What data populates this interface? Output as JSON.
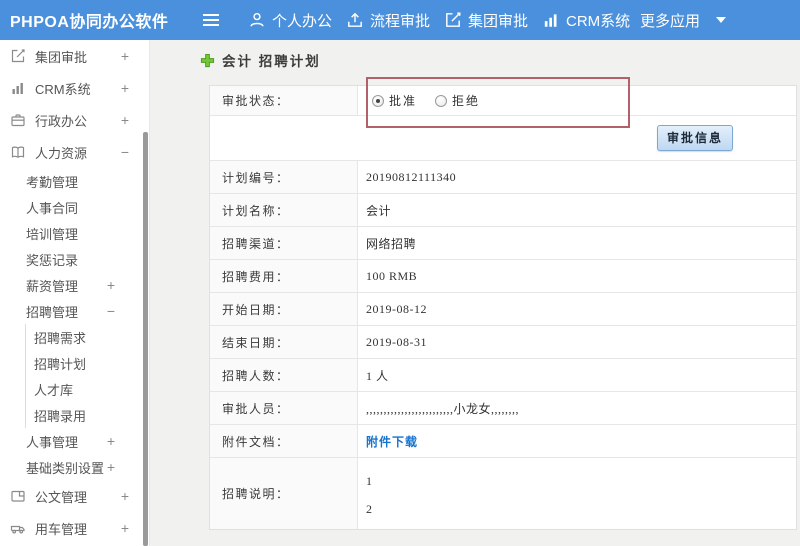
{
  "topbar": {
    "brand": "PHPOA协同办公软件",
    "nav": [
      {
        "icon": "user-icon",
        "label": "个人办公"
      },
      {
        "icon": "upload-icon",
        "label": "流程审批"
      },
      {
        "icon": "edit-icon",
        "label": "集团审批"
      },
      {
        "icon": "chart-icon",
        "label": "CRM系统"
      },
      {
        "icon": "caret-down-icon",
        "label": "更多应用"
      }
    ]
  },
  "sidebar": {
    "items": [
      {
        "label": "集团审批",
        "level": 1,
        "icon": "edit-icon",
        "expander": "+"
      },
      {
        "label": "CRM系统",
        "level": 1,
        "icon": "chart-icon",
        "expander": "+"
      },
      {
        "label": "行政办公",
        "level": 1,
        "icon": "briefcase-icon",
        "expander": "+"
      },
      {
        "label": "人力资源",
        "level": 1,
        "icon": "book-icon",
        "expander": "−"
      },
      {
        "label": "考勤管理",
        "level": 2,
        "expander": ""
      },
      {
        "label": "人事合同",
        "level": 2,
        "expander": ""
      },
      {
        "label": "培训管理",
        "level": 2,
        "expander": ""
      },
      {
        "label": "奖惩记录",
        "level": 2,
        "expander": ""
      },
      {
        "label": "薪资管理",
        "level": 2,
        "expander": "+"
      },
      {
        "label": "招聘管理",
        "level": 2,
        "expander": "−"
      },
      {
        "label": "招聘需求",
        "level": 3,
        "expander": ""
      },
      {
        "label": "招聘计划",
        "level": 3,
        "expander": ""
      },
      {
        "label": "人才库",
        "level": 3,
        "expander": ""
      },
      {
        "label": "招聘录用",
        "level": 3,
        "expander": ""
      },
      {
        "label": "人事管理",
        "level": 2,
        "expander": "+"
      },
      {
        "label": "基础类别设置",
        "level": 2,
        "expander": "+"
      },
      {
        "label": "公文管理",
        "level": 1,
        "icon": "doc-icon",
        "expander": "+"
      },
      {
        "label": "用车管理",
        "level": 1,
        "icon": "car-icon",
        "expander": "+"
      }
    ]
  },
  "breadcrumb": {
    "title": "会计 招聘计划"
  },
  "form": {
    "status": {
      "label": "审批状态：",
      "options": [
        {
          "label": "批准",
          "checked": true
        },
        {
          "label": "拒绝",
          "checked": false
        }
      ]
    },
    "approve_button": "审批信息",
    "rows": [
      {
        "label": "计划编号：",
        "value": "20190812111340"
      },
      {
        "label": "计划名称：",
        "value": "会计"
      },
      {
        "label": "招聘渠道：",
        "value": "网络招聘"
      },
      {
        "label": "招聘费用：",
        "value": "100 RMB"
      },
      {
        "label": "开始日期：",
        "value": "2019-08-12"
      },
      {
        "label": "结束日期：",
        "value": "2019-08-31"
      },
      {
        "label": "招聘人数：",
        "value": "1 人"
      },
      {
        "label": "审批人员：",
        "value": ",,,,,,,,,,,,,,,,,,,,,,,,,小龙女,,,,,,,,"
      },
      {
        "label": "附件文档：",
        "value": "附件下载"
      }
    ],
    "desc_row": {
      "label": "招聘说明：",
      "lines": [
        "1",
        "2"
      ]
    }
  },
  "colors": {
    "topbar_bg": "#4a90dc",
    "highlight_red": "#b4606a",
    "link_blue": "#1673cf",
    "plus_green": "#71c837"
  }
}
